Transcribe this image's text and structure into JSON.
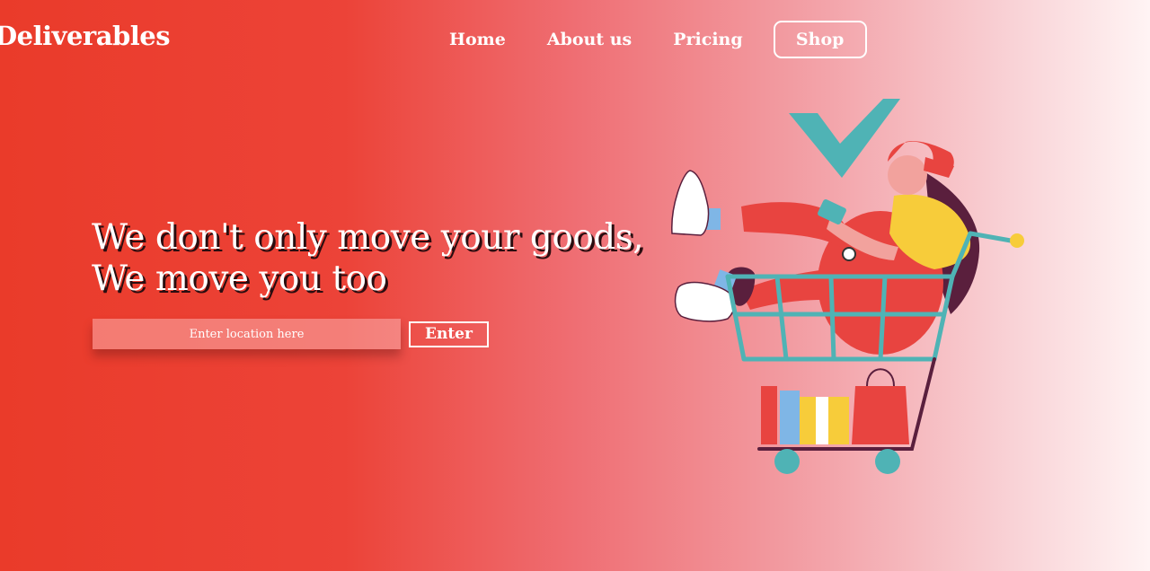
{
  "brand": {
    "logo_text": "Deliverables"
  },
  "nav": {
    "items": [
      {
        "label": "Home"
      },
      {
        "label": "About us"
      },
      {
        "label": "Pricing"
      }
    ],
    "shop_label": "Shop"
  },
  "hero": {
    "headline_line1": "We don't only move your goods,",
    "headline_line2": "We move you too",
    "search": {
      "placeholder": "Enter location here",
      "value": ""
    },
    "enter_label": "Enter"
  },
  "colors": {
    "gradient_start": "#ea3b2a",
    "gradient_end": "#fff4f4",
    "teal_accent": "#4fb3b5",
    "cart_red": "#e84440",
    "shirt_yellow": "#f7cc3a"
  },
  "icons": {
    "illustration": "shopping-cart-girl-illustration",
    "checkmark": "checkmark-icon"
  }
}
